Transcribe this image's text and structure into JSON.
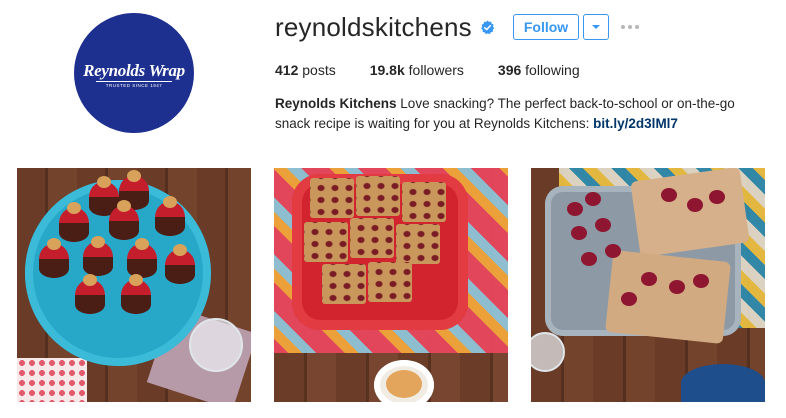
{
  "profile": {
    "username": "reynoldskitchens",
    "verified": true,
    "follow_label": "Follow",
    "avatar": {
      "brand_text": "Reynolds Wrap",
      "tagline": "TRUSTED SINCE 1947",
      "color": "#1d2f8f"
    }
  },
  "stats": {
    "posts_count": "412",
    "posts_label": "posts",
    "followers_count": "19.8k",
    "followers_label": "followers",
    "following_count": "396",
    "following_label": "following"
  },
  "bio": {
    "name": "Reynolds Kitchens",
    "text": "Love snacking? The perfect back-to-school or on-the-go snack recipe is waiting for you at Reynolds Kitchens:",
    "link": "bit.ly/2d3lMl7"
  },
  "colors": {
    "accent": "#3897f0",
    "link": "#003569",
    "verified": "#3897f0"
  },
  "icons": {
    "verified": "verified-badge-icon",
    "dropdown": "chevron-down-icon",
    "more": "more-options-icon"
  }
}
